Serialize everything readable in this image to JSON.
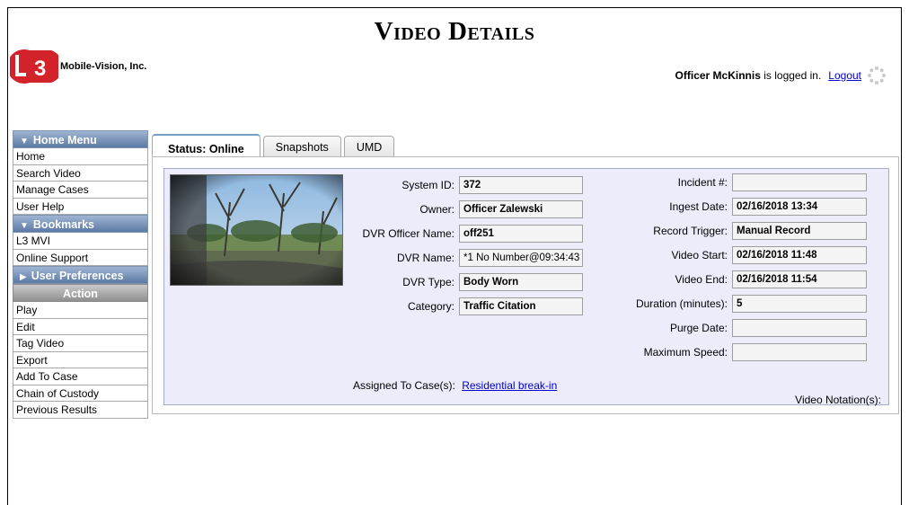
{
  "header": {
    "title": "Video Details",
    "company": "Mobile-Vision, Inc.",
    "logo_mark": "L3",
    "login_user": "Officer McKinnis",
    "login_suffix": " is logged in.",
    "logout_label": "Logout"
  },
  "sidebar": {
    "home_menu": {
      "label": "Home Menu",
      "items": [
        "Home",
        "Search Video",
        "Manage Cases",
        "User Help"
      ]
    },
    "bookmarks": {
      "label": "Bookmarks",
      "items": [
        "L3 MVI",
        "Online Support"
      ]
    },
    "user_prefs": {
      "label": "User Preferences"
    },
    "action": {
      "label": "Action",
      "items": [
        "Play",
        "Edit",
        "Tag Video",
        "Export",
        "Add To Case",
        "Chain of Custody",
        "Previous Results"
      ]
    }
  },
  "tabs": [
    {
      "label": "Status: Online",
      "active": true
    },
    {
      "label": "Snapshots",
      "active": false
    },
    {
      "label": "UMD",
      "active": false
    }
  ],
  "details": {
    "system_id": {
      "label": "System ID:",
      "value": "372"
    },
    "owner": {
      "label": "Owner:",
      "value": "Officer Zalewski"
    },
    "dvr_officer_name": {
      "label": "DVR Officer Name:",
      "value": "off251"
    },
    "dvr_name": {
      "label": "DVR Name:",
      "value": "*1 No Number@09:34:43"
    },
    "dvr_type": {
      "label": "DVR Type:",
      "value": "Body Worn"
    },
    "category": {
      "label": "Category:",
      "value": "Traffic Citation"
    },
    "incident": {
      "label": "Incident #:",
      "value": ""
    },
    "ingest_date": {
      "label": "Ingest Date:",
      "value": "02/16/2018 13:34"
    },
    "record_trigger": {
      "label": "Record Trigger:",
      "value": "Manual Record"
    },
    "video_start": {
      "label": "Video Start:",
      "value": "02/16/2018 11:48"
    },
    "video_end": {
      "label": "Video End:",
      "value": "02/16/2018 11:54"
    },
    "duration": {
      "label": "Duration (minutes):",
      "value": "5"
    },
    "purge_date": {
      "label": "Purge Date:",
      "value": ""
    },
    "max_speed": {
      "label": "Maximum Speed:",
      "value": ""
    },
    "assigned_label": "Assigned To Case(s):",
    "assigned_case": "Residential break-in",
    "notation_label": "Video Notation(s):"
  },
  "colors": {
    "menu_header": "#5c7aa5",
    "action_header": "#8f8f8f",
    "panel_bg": "#ececfb",
    "link": "#0000cc",
    "logo_red": "#d2232a"
  }
}
